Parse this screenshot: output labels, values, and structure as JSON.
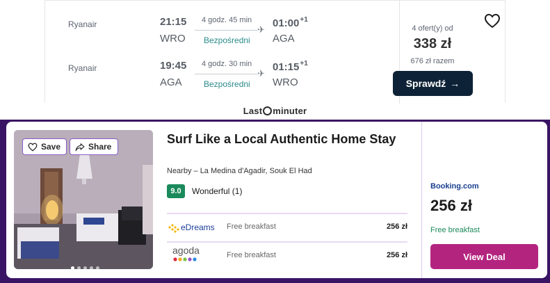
{
  "flight": {
    "legs": [
      {
        "airline": "Ryanair",
        "dep_time": "21:15",
        "dep_code": "WRO",
        "duration": "4 godz. 45 min",
        "stops": "Bezpośredni",
        "arr_time": "01:00",
        "arr_offset": "+1",
        "arr_code": "AGA"
      },
      {
        "airline": "Ryanair",
        "dep_time": "19:45",
        "dep_code": "AGA",
        "duration": "4 godz. 30 min",
        "stops": "Bezpośredni",
        "arr_time": "01:15",
        "arr_offset": "+1",
        "arr_code": "WRO"
      }
    ],
    "offers_text": "4 ofert(y) od",
    "price": "338 zł",
    "total_text": "676 zł razem",
    "check_button": "Sprawdź",
    "provider": {
      "before": "Last",
      "after": "minuter"
    },
    "colors": {
      "button": "#0d2236",
      "stops": "#2a8a8a"
    }
  },
  "hotel": {
    "save_label": "Save",
    "share_label": "Share",
    "title": "Surf Like a Local Authentic Home Stay",
    "location": "Nearby – La Medina d'Agadir, Souk El Had",
    "rating_score": "9.0",
    "rating_text": "Wonderful (1)",
    "offers": [
      {
        "partner": "eDreams",
        "perk": "Free breakfast",
        "price": "256 zł"
      },
      {
        "partner": "agoda",
        "perk": "Free breakfast",
        "price": "256 zł"
      }
    ],
    "deal": {
      "provider": "Booking.com",
      "price": "256 zł",
      "perk": "Free breakfast",
      "button": "View Deal"
    },
    "photo_dots": {
      "count": 5,
      "active_index": 0
    },
    "colors": {
      "band": "#3a1464",
      "rating": "#1a8a5a",
      "view_deal": "#b3247f"
    }
  }
}
